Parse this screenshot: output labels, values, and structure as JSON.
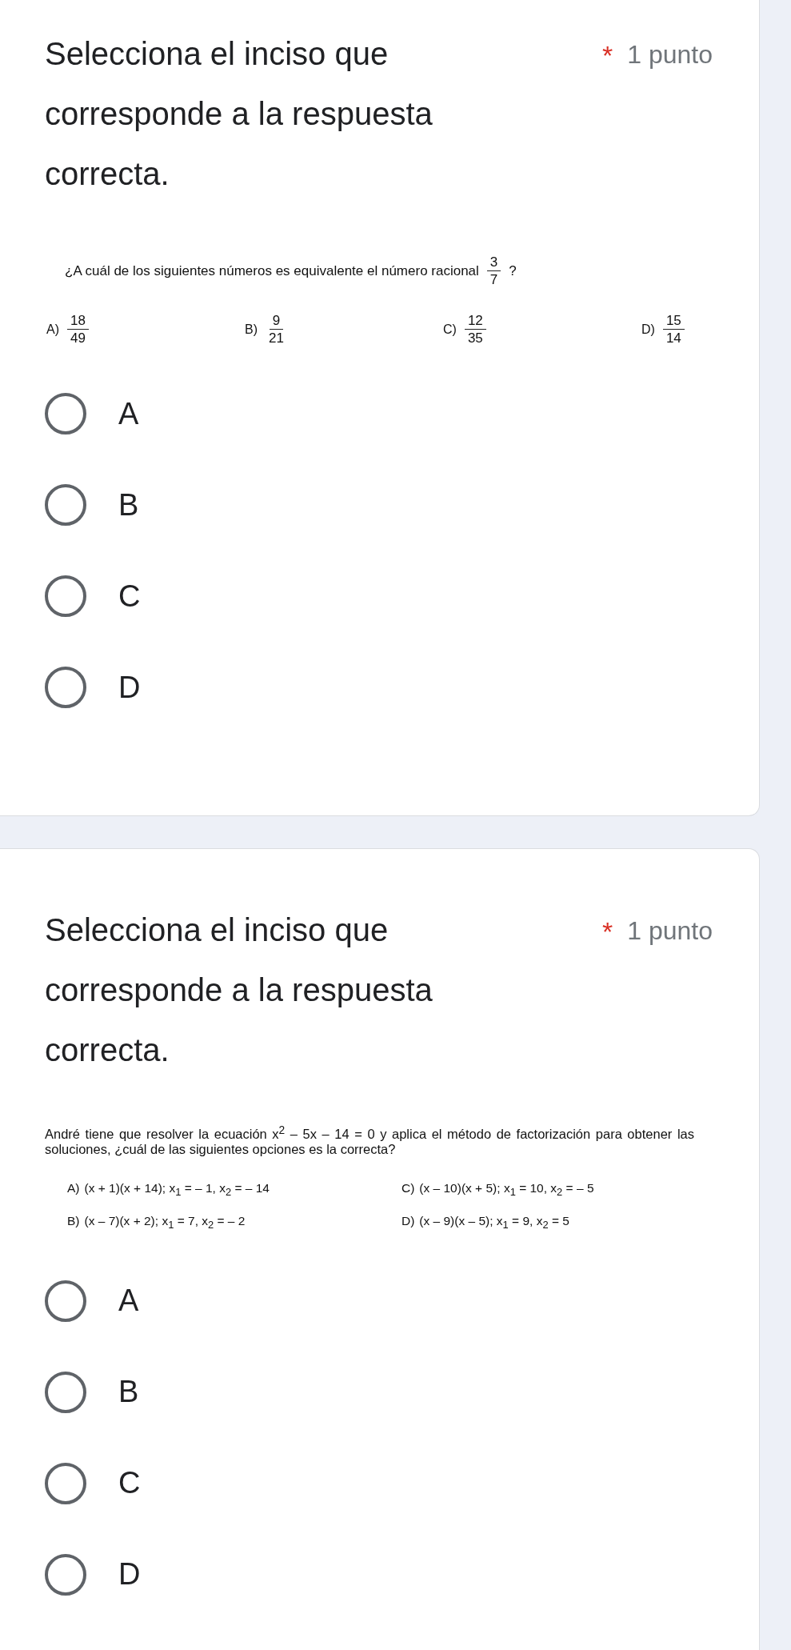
{
  "questions": [
    {
      "title": "Selecciona el inciso que corresponde a la respuesta correcta.",
      "required_mark": "*",
      "points": "1 punto",
      "prompt": {
        "kind": "fraction",
        "text": "¿A cuál de los siguientes números es equivalente el número racional",
        "numerator": "3",
        "denominator": "7",
        "after": "?",
        "answers": [
          {
            "label": "A)",
            "numerator": "18",
            "denominator": "49"
          },
          {
            "label": "B)",
            "numerator": "9",
            "denominator": "21"
          },
          {
            "label": "C)",
            "numerator": "12",
            "denominator": "35"
          },
          {
            "label": "D)",
            "numerator": "15",
            "denominator": "14"
          }
        ]
      },
      "options": [
        {
          "label": "A",
          "selected": false
        },
        {
          "label": "B",
          "selected": false
        },
        {
          "label": "C",
          "selected": false
        },
        {
          "label": "D",
          "selected": false
        }
      ]
    },
    {
      "title": "Selecciona el inciso que corresponde a la respuesta correcta.",
      "required_mark": "*",
      "points": "1 punto",
      "prompt": {
        "kind": "equation",
        "text": "André tiene que resolver la ecuación x$^{2}$ – 5x – 14 = 0 y aplica el método de factorización para obtener las soluciones, ¿cuál de las siguientes opciones es la correcta?",
        "answers": [
          {
            "label": "A)",
            "text": "(x + 1)(x + 14); x$_{1}$ = – 1, x$_{2}$ = – 14"
          },
          {
            "label": "C)",
            "text": "(x – 10)(x + 5); x$_{1}$ = 10, x$_{2}$ = – 5"
          },
          {
            "label": "B)",
            "text": "(x – 7)(x + 2); x$_{1}$ = 7, x$_{2}$ = – 2"
          },
          {
            "label": "D)",
            "text": "(x – 9)(x – 5); x$_{1}$ = 9, x$_{2}$ = 5"
          }
        ]
      },
      "options": [
        {
          "label": "A",
          "selected": false
        },
        {
          "label": "B",
          "selected": false
        },
        {
          "label": "C",
          "selected": false
        },
        {
          "label": "D",
          "selected": false
        }
      ]
    }
  ]
}
